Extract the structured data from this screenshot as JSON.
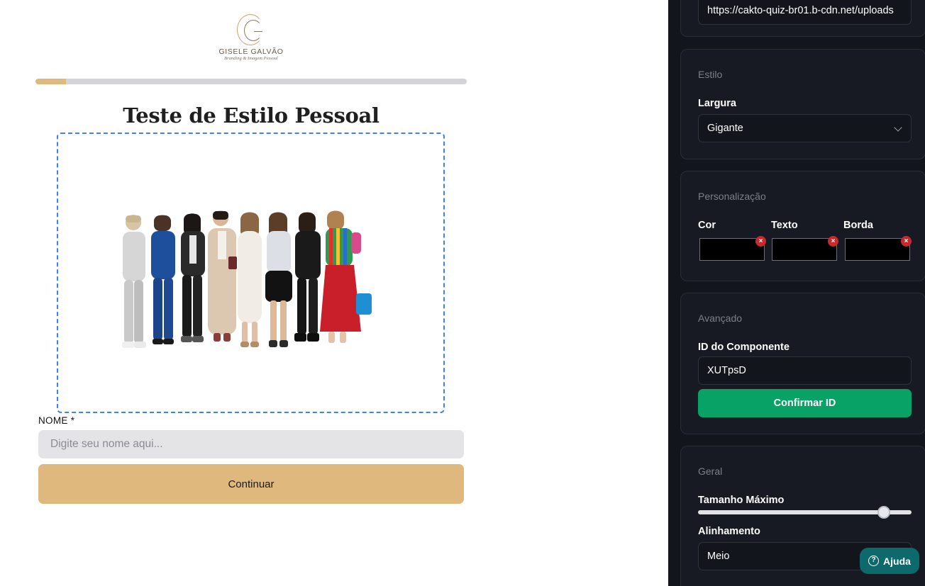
{
  "quiz": {
    "brand": {
      "name": "GISELE GALVÃO",
      "tagline": "Branding & Imagem Pessoal"
    },
    "progress": 0.07,
    "title": "Teste de Estilo Pessoal",
    "name_label": "NOME *",
    "name_placeholder": "Digite seu nome aqui...",
    "continue_label": "Continuar"
  },
  "panel": {
    "url_value": "https://cakto-quiz-br01.b-cdn.net/uploads",
    "estilo": {
      "title": "Estilo",
      "width_label": "Largura",
      "width_value": "Gigante"
    },
    "personalizacao": {
      "title": "Personalização",
      "cor_label": "Cor",
      "texto_label": "Texto",
      "borda_label": "Borda",
      "remove_glyph": "×"
    },
    "avancado": {
      "title": "Avançado",
      "id_label": "ID do Componente",
      "id_value": "XUTpsD",
      "confirm_label": "Confirmar ID"
    },
    "geral": {
      "title": "Geral",
      "max_size_label": "Tamanho Máximo",
      "max_size_value": 0.87,
      "align_label": "Alinhamento",
      "align_value": "Meio"
    },
    "help_label": "Ajuda",
    "help_glyph": "?"
  },
  "colors": {
    "accent": "#dfb87d",
    "selection": "#3b82f6",
    "confirm": "#08a266",
    "help": "#0c6a6c",
    "remove": "#c8292d",
    "panel_bg": "#13151c"
  }
}
